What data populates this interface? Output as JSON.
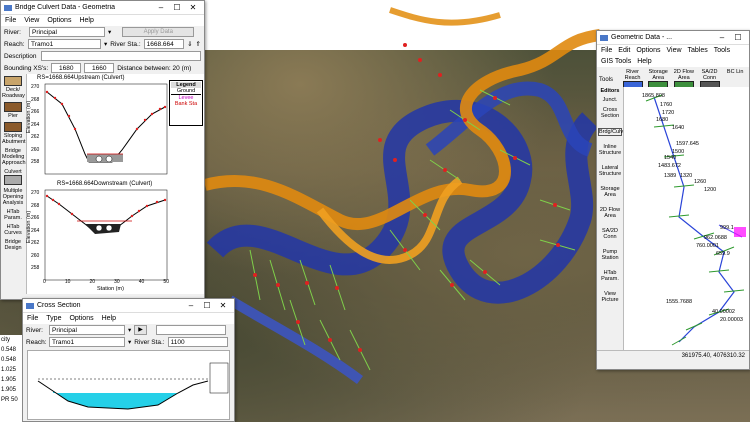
{
  "bridge": {
    "title": "Bridge Culvert Data - Geometria",
    "menu": [
      "File",
      "View",
      "Options",
      "Help"
    ],
    "river_label": "River:",
    "river_value": "Principal",
    "apply_label": "Apply Data",
    "reach_label": "Reach:",
    "reach_value": "Tramo1",
    "station_label": "River Sta.:",
    "station_value": "1668.664",
    "description_label": "Description",
    "bounding_label": "Bounding XS's:",
    "bounding_1": "1680",
    "bounding_2": "1660",
    "distance_label": "Distance between: 20 (m)",
    "side_buttons": [
      "Deck/ Roadway",
      "Pier",
      "Sloping Abutment",
      "Bridge Modeling Approach",
      "Culvert",
      "Multiple Opening Analysis",
      "HTab Param.",
      "HTab Curves",
      "Bridge Design"
    ],
    "plot1_title": "RS=1668.664Upstream  (Culvert)",
    "plot2_title": "RS=1668.664Downstream  (Culvert)",
    "ylabel": "Elevation (m)",
    "xlabel": "Station (m)",
    "legend_title": "Legend",
    "legend_items": [
      "Ground",
      "Levee",
      "Bank Sta"
    ],
    "y1_ticks": [
      "270",
      "268",
      "266",
      "264",
      "262",
      "260",
      "258"
    ],
    "y2_ticks": [
      "270",
      "268",
      "266",
      "264",
      "262",
      "260",
      "258"
    ],
    "x_ticks": [
      "0",
      "10",
      "20",
      "30",
      "40",
      "50"
    ]
  },
  "cross": {
    "title": "Cross Section",
    "menu": [
      "File",
      "Type",
      "Options",
      "Help"
    ],
    "river_label": "River:",
    "river_value": "Principal",
    "reach_label": "Reach:",
    "reach_value": "Tramo1",
    "station_label": "River Sta.:",
    "station_value": "1100",
    "left_values": [
      "city",
      "0.548",
      "0.548",
      "1.025",
      "1.905",
      "1.905",
      "PR 50"
    ]
  },
  "geo": {
    "title": "Geometric Data - ...",
    "menu": [
      "File",
      "Edit",
      "Options",
      "View",
      "Tables",
      "Tools"
    ],
    "menu2": [
      "GIS Tools",
      "Help"
    ],
    "tools_label": "Tools",
    "editors_label": "Editors",
    "toolbar": [
      "River Reach",
      "Storage Area",
      "2D Flow Area",
      "SA/2D Conn",
      "BC Lin"
    ],
    "editors": [
      "Junct.",
      "Cross Section",
      "Brdg/Culv",
      "Inline Structure",
      "Lateral Structure",
      "Storage Area",
      "2D Flow Area",
      "SA/2D Conn",
      "Pump Station",
      "HTab Param.",
      "View Picture"
    ],
    "stations": [
      "1865.808",
      "1760",
      "1720",
      "1680",
      "1640",
      "1597.645",
      "1540",
      "1500",
      "1483.672",
      "1389",
      "1320",
      "1260",
      "1200",
      "999.1",
      "962.0688",
      "760.0001",
      "659.9",
      "1555.7688",
      "40.00002",
      "20.00003"
    ],
    "coords": "361975.40, 4076310.32"
  }
}
